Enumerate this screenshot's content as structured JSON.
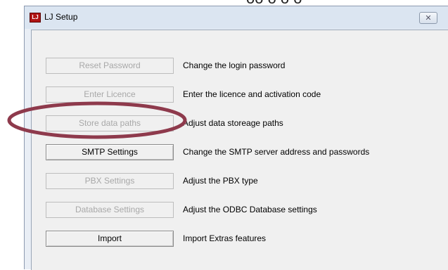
{
  "window": {
    "title": "LJ Setup",
    "app_icon_text": "LJ",
    "close_glyph": "✕"
  },
  "buttons": [
    {
      "label": "Reset Password",
      "description": "Change the login password",
      "enabled": false
    },
    {
      "label": "Enter Licence",
      "description": "Enter the licence and activation code",
      "enabled": false
    },
    {
      "label": "Store data paths",
      "description": "Adjust data storeage paths",
      "enabled": false
    },
    {
      "label": "SMTP Settings",
      "description": "Change the SMTP server address and passwords",
      "enabled": true
    },
    {
      "label": "PBX Settings",
      "description": "Adjust the PBX type",
      "enabled": false
    },
    {
      "label": "Database Settings",
      "description": "Adjust the ODBC Database settings",
      "enabled": false
    },
    {
      "label": "Import",
      "description": "Import Extras features",
      "enabled": true
    }
  ],
  "annotation": {
    "color": "#8e3a4c",
    "target": "Store data paths"
  }
}
